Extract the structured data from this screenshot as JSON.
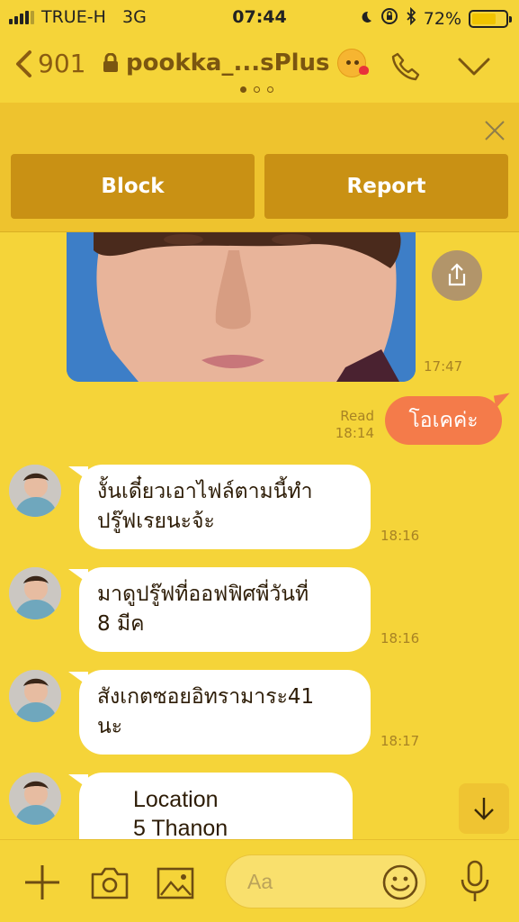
{
  "status_bar": {
    "carrier": "TRUE-H",
    "network": "3G",
    "time": "07:44",
    "battery": "72%",
    "battery_level": 0.72
  },
  "header": {
    "back_count": "901",
    "title": "pookka_...sPlus",
    "page_dots": 3,
    "active_dot": 0
  },
  "panel": {
    "block_label": "Block",
    "report_label": "Report"
  },
  "messages": {
    "photo_time": "17:47",
    "outgoing": {
      "text": "โอเคค่ะ",
      "read_label": "Read",
      "time": "18:14"
    },
    "incoming": [
      {
        "line1": "งั้นเดี๋ยวเอาไฟล์ตามนี้ทำ",
        "line2": "ปรู๊ฟเรยนะจ้ะ",
        "time": "18:16"
      },
      {
        "line1": "มาดูปรู๊ฟที่ออฟฟิศพี่วันที่",
        "line2": "8 มีค",
        "time": "18:16"
      },
      {
        "line1": "สังเกตซอยอิทรามาระ41",
        "line2": "นะ",
        "time": "18:17"
      }
    ],
    "location": {
      "line1": "Location",
      "line2": "5 Thanon"
    }
  },
  "input_bar": {
    "placeholder": "Aa"
  },
  "colors": {
    "background": "#f5d439",
    "header_text": "#7b5610",
    "panel_button": "#c99114",
    "outgoing_bubble": "#f47b4a",
    "incoming_bubble": "#ffffff",
    "timestamp": "#a88324"
  },
  "icons": {
    "back": "chevron-left-icon",
    "lock": "lock-icon",
    "call": "phone-icon",
    "menu": "chevron-down-icon",
    "close": "close-icon",
    "share": "share-icon",
    "scroll": "arrow-down-icon",
    "plus": "plus-icon",
    "camera": "camera-icon",
    "gallery": "image-icon",
    "emoji": "smiley-icon",
    "mic": "microphone-icon"
  }
}
